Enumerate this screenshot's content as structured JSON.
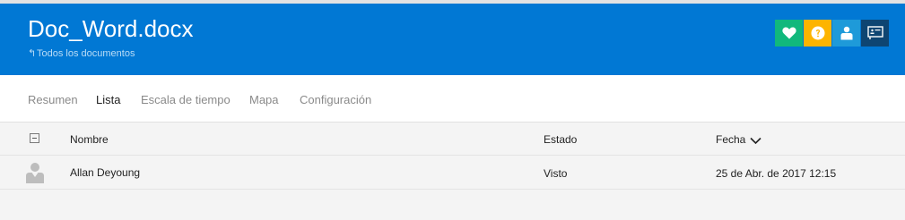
{
  "header": {
    "title": "Doc_Word.docx",
    "back_link": "Todos los documentos",
    "back_arrow": "↰",
    "icons": [
      {
        "name": "heart-icon",
        "color": "#11b87c"
      },
      {
        "name": "help-icon",
        "color": "#fdb400"
      },
      {
        "name": "person-icon",
        "color": "#1e9ad9"
      },
      {
        "name": "present-icon",
        "color": "#0e4572"
      }
    ]
  },
  "tabs": [
    {
      "label": "Resumen",
      "active": false
    },
    {
      "label": "Lista",
      "active": true
    },
    {
      "label": "Escala de tiempo",
      "active": false
    },
    {
      "label": "Mapa",
      "active": false
    },
    {
      "label": "Configuración",
      "active": false
    }
  ],
  "table": {
    "columns": {
      "name": "Nombre",
      "status": "Estado",
      "date": "Fecha"
    },
    "sort_column": "date",
    "sort_direction": "descending",
    "rows": [
      {
        "name": "Allan Deyoung",
        "status": "Visto",
        "date": "25 de Abr. de 2017 12:15"
      }
    ]
  }
}
